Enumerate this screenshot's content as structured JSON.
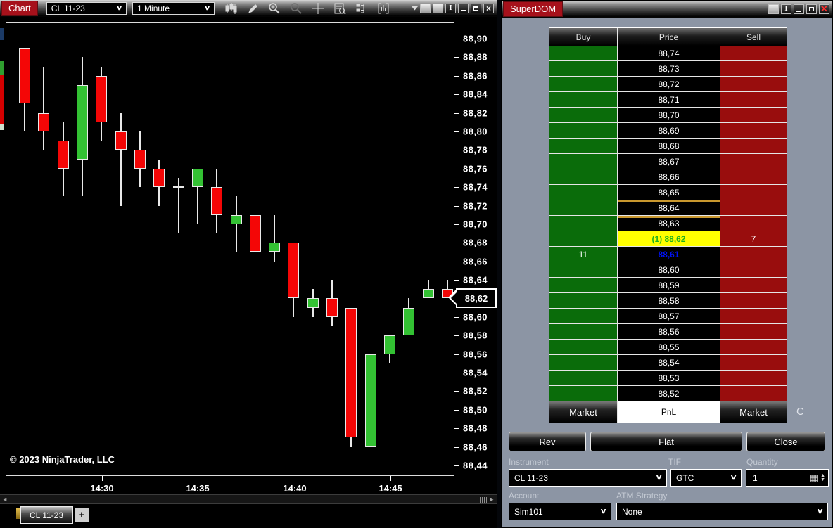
{
  "chart_window": {
    "title": "Chart",
    "instrument_value": "CL 11-23",
    "interval_value": "1 Minute",
    "toolbar_icon_names": [
      "chart-style-icon",
      "drawing-tools-icon",
      "zoom-in-icon",
      "zoom-out-icon",
      "crosshair-icon",
      "data-box-icon",
      "chart-trader-icon",
      "indicators-icon",
      "more-dropdown-icon"
    ],
    "window_button_names": [
      "workspace-button",
      "workspace-button",
      "pin-icon",
      "minimize-icon",
      "restore-icon",
      "close-icon"
    ],
    "copyright": "© 2023 NinjaTrader, LLC",
    "tab_label": "CL 11-23",
    "new_tab_label": "+",
    "price_marker": "88,62"
  },
  "chart_data": {
    "type": "candlestick",
    "instrument": "CL 11-23",
    "interval": "1 Minute",
    "y_axis": {
      "min": 88.44,
      "max": 88.9,
      "tick_step": 0.02,
      "format": "comma-decimal",
      "current_price": 88.62
    },
    "x_ticks": [
      {
        "label": "14:30",
        "x": 145
      },
      {
        "label": "14:35",
        "x": 281
      },
      {
        "label": "14:40",
        "x": 419
      },
      {
        "label": "14:45",
        "x": 555
      }
    ],
    "candles": [
      {
        "o": 88.89,
        "h": 88.89,
        "l": 88.8,
        "c": 88.83,
        "dir": "down"
      },
      {
        "o": 88.82,
        "h": 88.87,
        "l": 88.78,
        "c": 88.8,
        "dir": "down"
      },
      {
        "o": 88.79,
        "h": 88.81,
        "l": 88.73,
        "c": 88.76,
        "dir": "down"
      },
      {
        "o": 88.77,
        "h": 88.88,
        "l": 88.73,
        "c": 88.85,
        "dir": "up"
      },
      {
        "o": 88.86,
        "h": 88.87,
        "l": 88.79,
        "c": 88.81,
        "dir": "down"
      },
      {
        "o": 88.8,
        "h": 88.82,
        "l": 88.72,
        "c": 88.78,
        "dir": "down"
      },
      {
        "o": 88.78,
        "h": 88.8,
        "l": 88.74,
        "c": 88.76,
        "dir": "down"
      },
      {
        "o": 88.76,
        "h": 88.77,
        "l": 88.72,
        "c": 88.74,
        "dir": "down"
      },
      {
        "o": 88.74,
        "h": 88.75,
        "l": 88.69,
        "c": 88.74,
        "dir": "doji"
      },
      {
        "o": 88.74,
        "h": 88.76,
        "l": 88.7,
        "c": 88.76,
        "dir": "up"
      },
      {
        "o": 88.74,
        "h": 88.76,
        "l": 88.69,
        "c": 88.71,
        "dir": "down"
      },
      {
        "o": 88.7,
        "h": 88.73,
        "l": 88.67,
        "c": 88.71,
        "dir": "up"
      },
      {
        "o": 88.71,
        "h": 88.71,
        "l": 88.67,
        "c": 88.67,
        "dir": "down"
      },
      {
        "o": 88.67,
        "h": 88.71,
        "l": 88.66,
        "c": 88.68,
        "dir": "up"
      },
      {
        "o": 88.68,
        "h": 88.68,
        "l": 88.6,
        "c": 88.62,
        "dir": "down"
      },
      {
        "o": 88.61,
        "h": 88.63,
        "l": 88.6,
        "c": 88.62,
        "dir": "up"
      },
      {
        "o": 88.62,
        "h": 88.64,
        "l": 88.59,
        "c": 88.6,
        "dir": "down"
      },
      {
        "o": 88.61,
        "h": 88.61,
        "l": 88.46,
        "c": 88.47,
        "dir": "down"
      },
      {
        "o": 88.46,
        "h": 88.56,
        "l": 88.46,
        "c": 88.56,
        "dir": "up"
      },
      {
        "o": 88.56,
        "h": 88.58,
        "l": 88.55,
        "c": 88.58,
        "dir": "up"
      },
      {
        "o": 88.58,
        "h": 88.62,
        "l": 88.58,
        "c": 88.61,
        "dir": "up"
      },
      {
        "o": 88.62,
        "h": 88.64,
        "l": 88.62,
        "c": 88.63,
        "dir": "up"
      },
      {
        "o": 88.63,
        "h": 88.64,
        "l": 88.62,
        "c": 88.62,
        "dir": "down"
      }
    ]
  },
  "superdom": {
    "title": "SuperDOM",
    "window_button_names": [
      "workspace-button",
      "pin-icon",
      "minimize-icon",
      "restore-icon",
      "close-icon"
    ],
    "columns": [
      "Buy",
      "Price",
      "Sell"
    ],
    "rows": [
      {
        "price": "88,74"
      },
      {
        "price": "88,73"
      },
      {
        "price": "88,72"
      },
      {
        "price": "88,71"
      },
      {
        "price": "88,70"
      },
      {
        "price": "88,69"
      },
      {
        "price": "88,68"
      },
      {
        "price": "88,67"
      },
      {
        "price": "88,66"
      },
      {
        "price": "88,65"
      },
      {
        "price": "88,64",
        "gold_top": true
      },
      {
        "price": "88,63",
        "gold_top": true
      },
      {
        "price": "(1) 88,62",
        "highlight": true,
        "sell": "7"
      },
      {
        "price": "88,61",
        "blue_price": true,
        "buy": "11"
      },
      {
        "price": "88,60"
      },
      {
        "price": "88,59"
      },
      {
        "price": "88,58"
      },
      {
        "price": "88,57"
      },
      {
        "price": "88,56"
      },
      {
        "price": "88,55"
      },
      {
        "price": "88,54"
      },
      {
        "price": "88,53"
      },
      {
        "price": "88,52"
      }
    ],
    "market_row": {
      "buy": "Market",
      "center": "PnL",
      "sell": "Market"
    },
    "side_letter": "C",
    "buttons": {
      "rev": "Rev",
      "flat": "Flat",
      "close": "Close"
    },
    "fields": {
      "instrument_label": "Instrument",
      "instrument_value": "CL 11-23",
      "tif_label": "TIF",
      "tif_value": "GTC",
      "quantity_label": "Quantity",
      "quantity_value": "1",
      "account_label": "Account",
      "account_value": "Sim101",
      "atm_label": "ATM Strategy",
      "atm_value": "None"
    },
    "colors": {
      "buy_cell": "#0a6c0a",
      "sell_cell": "#990d0d",
      "highlight_row": "#ffff00",
      "highlight_text": "#1db11d",
      "order_marker_gold": "#c9982e",
      "position_price_blue": "#0013f2",
      "background": "#8c95a4"
    }
  },
  "colors": {
    "candle_up": "#33c133",
    "candle_down": "#f40606",
    "accent_red": "#a6111b"
  }
}
